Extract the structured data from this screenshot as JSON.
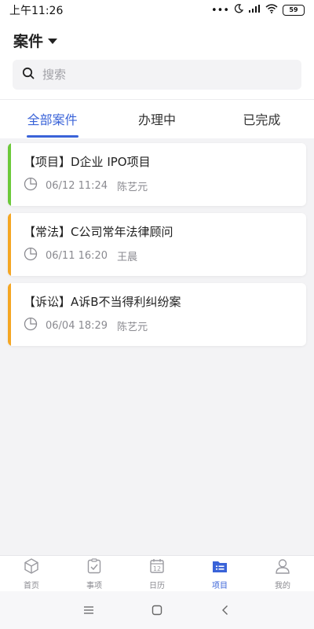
{
  "status_bar": {
    "time": "上午11:26",
    "dots": "•••",
    "battery": "59"
  },
  "header": {
    "title": "案件"
  },
  "search": {
    "placeholder": "搜索",
    "value": ""
  },
  "tabs": [
    {
      "label": "全部案件",
      "active": true
    },
    {
      "label": "办理中",
      "active": false
    },
    {
      "label": "已完成",
      "active": false
    }
  ],
  "cases": [
    {
      "title": "【项目】D企业 IPO项目",
      "time": "06/12 11:24",
      "person": "陈艺元",
      "accent": "#6cc93a"
    },
    {
      "title": "【常法】C公司常年法律顾问",
      "time": "06/11 16:20",
      "person": "王晨",
      "accent": "#f5a623"
    },
    {
      "title": "【诉讼】A诉B不当得利纠纷案",
      "time": "06/04 18:29",
      "person": "陈艺元",
      "accent": "#f5a623"
    }
  ],
  "bottom_nav": [
    {
      "label": "首页",
      "icon": "home-icon",
      "active": false
    },
    {
      "label": "事项",
      "icon": "clipboard-check-icon",
      "active": false
    },
    {
      "label": "日历",
      "icon": "calendar-icon",
      "calendar_day": "12",
      "active": false
    },
    {
      "label": "项目",
      "icon": "folder-icon",
      "active": true
    },
    {
      "label": "我的",
      "icon": "person-icon",
      "active": false
    }
  ],
  "colors": {
    "accent": "#3a63d8",
    "muted": "#8a8a90",
    "background": "#f3f3f5"
  }
}
